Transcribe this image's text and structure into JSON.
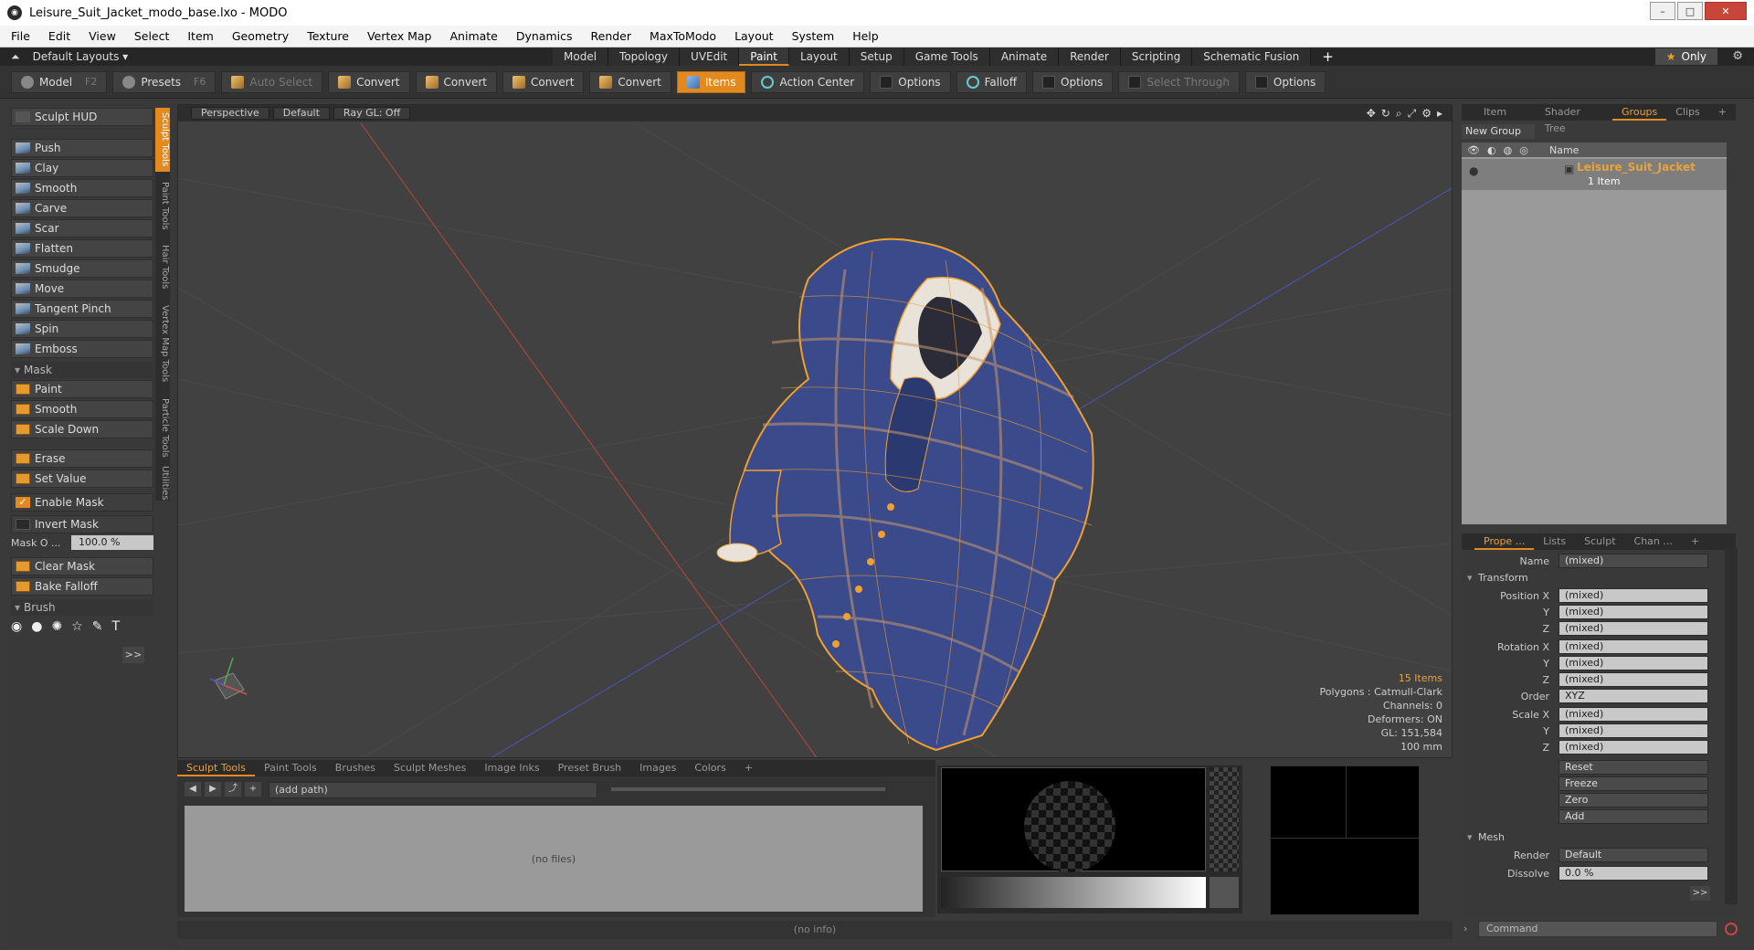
{
  "window": {
    "title": "Leisure_Suit_Jacket_modo_base.lxo - MODO"
  },
  "menu": [
    "File",
    "Edit",
    "View",
    "Select",
    "Item",
    "Geometry",
    "Texture",
    "Vertex Map",
    "Animate",
    "Dynamics",
    "Render",
    "MaxToModo",
    "Layout",
    "System",
    "Help"
  ],
  "layouts": {
    "label": "Default Layouts ▾"
  },
  "tabs": [
    "Model",
    "Topology",
    "UVEdit",
    "Paint",
    "Layout",
    "Setup",
    "Game Tools",
    "Animate",
    "Render",
    "Scripting",
    "Schematic Fusion"
  ],
  "active_tab": "Paint",
  "only": {
    "label": "Only"
  },
  "toolbar": {
    "model": "Model",
    "model_key": "F2",
    "presets": "Presets",
    "presets_key": "F6",
    "auto_select": "Auto Select",
    "convert1": "Convert",
    "convert2": "Convert",
    "convert3": "Convert",
    "convert4": "Convert",
    "items": "Items",
    "action_center": "Action Center",
    "options1": "Options",
    "falloff": "Falloff",
    "options2": "Options",
    "select_through": "Select Through",
    "options3": "Options"
  },
  "left_panel": {
    "sculpt_hud": "Sculpt HUD",
    "tools": [
      "Push",
      "Clay",
      "Smooth",
      "Carve",
      "Scar",
      "Flatten",
      "Smudge",
      "Move",
      "Tangent Pinch",
      "Spin",
      "Emboss"
    ],
    "mask_section": "Mask",
    "mask_tools": [
      "Paint",
      "Smooth",
      "Scale Down"
    ],
    "erase": "Erase",
    "set_value": "Set Value",
    "enable_mask": "Enable Mask",
    "invert_mask": "Invert Mask",
    "mask_opacity_label": "Mask O ...",
    "mask_opacity_value": "100.0 %",
    "clear_mask": "Clear Mask",
    "bake_falloff": "Bake Falloff",
    "brush_section": "Brush",
    "more": ">>"
  },
  "vertical_tabs": [
    "Sculpt Tools",
    "Paint Tools",
    "Hair Tools",
    "Vertex Map Tools",
    "Particle Tools",
    "Utilities"
  ],
  "viewport": {
    "view": "Perspective",
    "shading": "Default",
    "raygl": "Ray GL: Off",
    "stats": {
      "items": "15 Items",
      "polygons": "Polygons : Catmull-Clark",
      "channels": "Channels: 0",
      "deformers": "Deformers: ON",
      "gl": "GL: 151,584",
      "scale": "100 mm"
    }
  },
  "bottom_panel": {
    "tabs": [
      "Sculpt Tools",
      "Paint Tools",
      "Brushes",
      "Sculpt Meshes",
      "Image Inks",
      "Preset Brush",
      "Images",
      "Colors"
    ],
    "path_placeholder": "(add path)",
    "no_files": "(no files)"
  },
  "info": "(no info)",
  "right_top": {
    "tabs": [
      "Item List",
      "Shader Tree",
      "Groups",
      "Clips"
    ],
    "active": "Groups",
    "new_group": "New Group",
    "col_name": "Name",
    "group_name": "Leisure_Suit_Jacket",
    "group_count": "1 Item"
  },
  "right_bottom": {
    "tabs": [
      "Prope ...",
      "Lists",
      "Sculpt",
      "Chan ..."
    ],
    "name_label": "Name",
    "name_value": "(mixed)",
    "transform": "Transform",
    "position_x": "Position X",
    "y": "Y",
    "z": "Z",
    "rotation_x": "Rotation X",
    "order_label": "Order",
    "order_value": "XYZ",
    "scale_x": "Scale X",
    "mixed": "(mixed)",
    "reset": "Reset",
    "freeze": "Freeze",
    "zero": "Zero",
    "add": "Add",
    "mesh": "Mesh",
    "render_label": "Render",
    "render_value": "Default",
    "dissolve_label": "Dissolve",
    "dissolve_value": "0.0 %",
    "more": ">>"
  },
  "command": {
    "placeholder": "Command"
  },
  "colors": {
    "accent": "#e28a1e",
    "jacket": "#3a4a8a",
    "wire": "#f0a030"
  }
}
